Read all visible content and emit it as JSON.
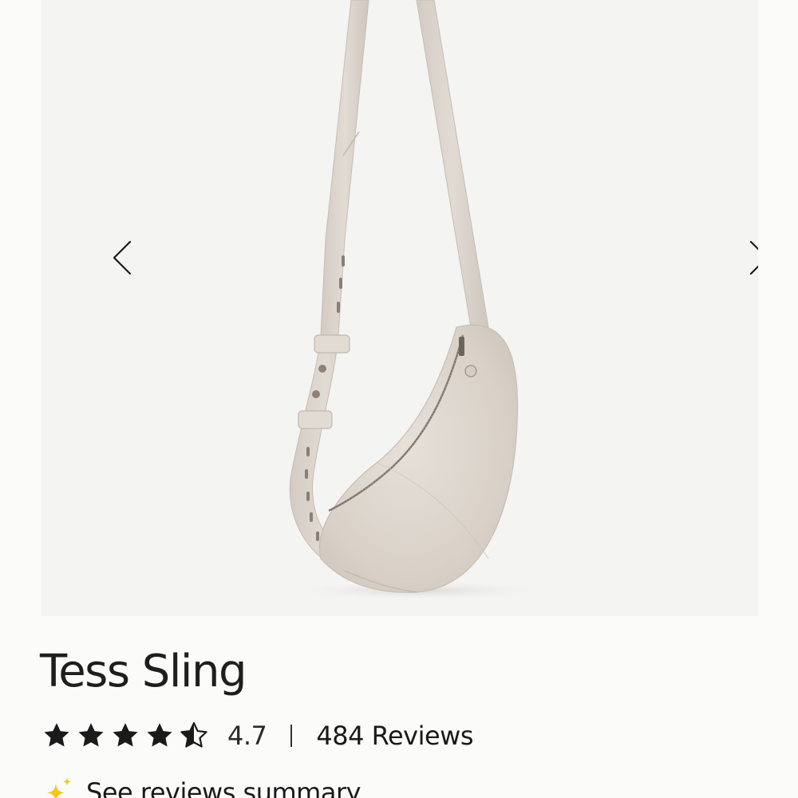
{
  "product": {
    "title": "Tess Sling",
    "rating_value": "4.7",
    "rating_stars": 4.5,
    "reviews_label": "484 Reviews",
    "summary_label": "See reviews summary"
  },
  "gallery": {
    "image": "product-photo",
    "prev_icon": "chevron-left-icon",
    "next_icon": "chevron-right-icon"
  },
  "colors": {
    "page_bg": "#fbfbfa",
    "gallery_bg": "#f4f4f3",
    "bag_leather": "#ddd5cd",
    "star_fill": "#1a1a1a",
    "sparkle": "#f5c518"
  }
}
